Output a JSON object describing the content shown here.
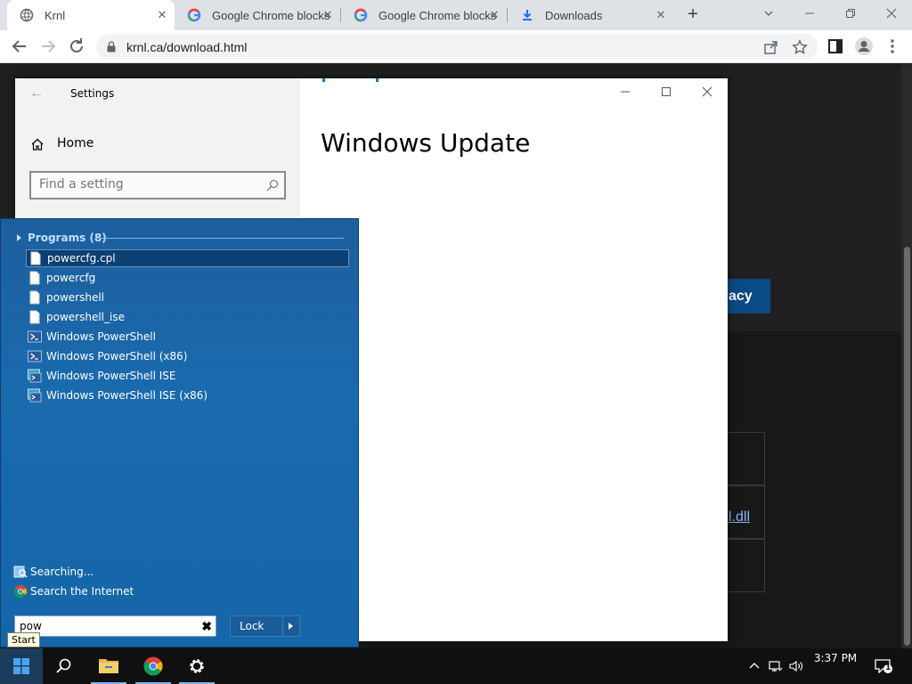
{
  "browser": {
    "tabs": [
      {
        "title": "Krnl",
        "active": true
      },
      {
        "title": "Google Chrome blocks",
        "active": false
      },
      {
        "title": "Google Chrome blocks",
        "active": false
      },
      {
        "title": "Downloads",
        "active": false
      }
    ],
    "url": "krnl.ca/download.html"
  },
  "webpage": {
    "privacy_button_label": "acy",
    "dll_link_text": "l.dll"
  },
  "settings_window": {
    "title": "Settings",
    "home_label": "Home",
    "search_placeholder": "Find a setting",
    "page_heading": "Windows Update"
  },
  "start_menu": {
    "programs_header": "Programs (8)",
    "programs": [
      {
        "label": "powercfg.cpl",
        "icon": "document-icon",
        "selected": true
      },
      {
        "label": "powercfg",
        "icon": "document-icon",
        "selected": false
      },
      {
        "label": "powershell",
        "icon": "document-icon",
        "selected": false
      },
      {
        "label": "powershell_ise",
        "icon": "document-icon",
        "selected": false
      },
      {
        "label": "Windows PowerShell",
        "icon": "powershell-icon",
        "selected": false
      },
      {
        "label": "Windows PowerShell (x86)",
        "icon": "powershell-icon",
        "selected": false
      },
      {
        "label": "Windows PowerShell ISE",
        "icon": "powershell-ise-icon",
        "selected": false
      },
      {
        "label": "Windows PowerShell ISE (x86)",
        "icon": "powershell-ise-icon",
        "selected": false
      }
    ],
    "searching_label": "Searching...",
    "search_internet_label": "Search the Internet",
    "search_value": "pow",
    "lock_label": "Lock",
    "tooltip": "Start"
  },
  "taskbar": {
    "time": "3:37 PM",
    "notification_count": "1"
  },
  "colors": {
    "start_menu_blue": "#1a6aae",
    "selection_blue": "#0c3f72",
    "privacy_button": "#0a4a86"
  }
}
